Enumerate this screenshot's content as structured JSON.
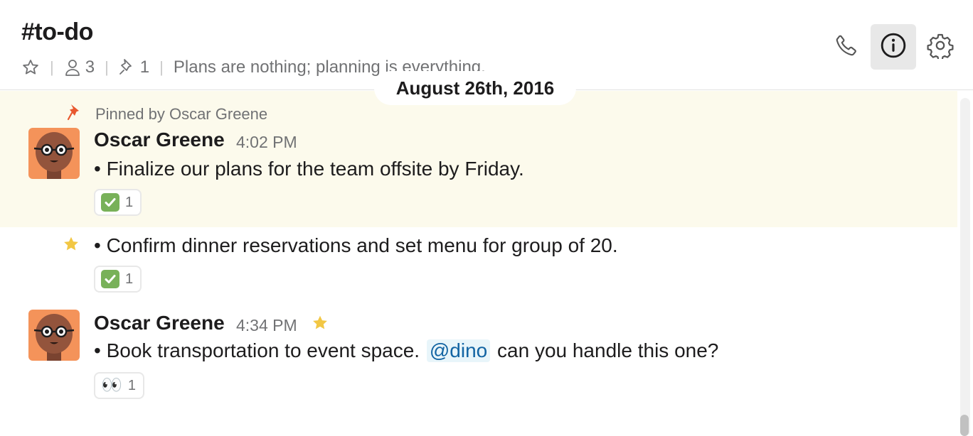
{
  "header": {
    "channel_name": "#to-do",
    "member_count": "3",
    "pinned_count": "1",
    "topic": "Plans are nothing; planning is everything."
  },
  "date_divider": "August 26th, 2016",
  "pinned_note": "Pinned by Oscar Greene",
  "messages": [
    {
      "sender": "Oscar Greene",
      "time": "4:02 PM",
      "text": "• Finalize our plans for the team offsite by Friday.",
      "reaction": {
        "emoji": "white-check-mark",
        "count": "1"
      },
      "pinned": true
    },
    {
      "text": "• Confirm dinner reservations and set menu for group of 20.",
      "reaction": {
        "emoji": "white-check-mark",
        "count": "1"
      },
      "starred": true
    },
    {
      "sender": "Oscar Greene",
      "time": "4:34 PM",
      "text_before": "• Book transportation to event space. ",
      "mention": "@dino",
      "text_after": " can you handle this one?",
      "reaction": {
        "emoji": "eyes",
        "emoji_glyph": "👀",
        "count": "1"
      },
      "starred": true
    }
  ],
  "colors": {
    "pinned_background": "#fcfaec",
    "mention_text": "#1264a3",
    "mention_background": "#e8f5fa",
    "star": "#f2c744",
    "pin": "#e8582f"
  }
}
